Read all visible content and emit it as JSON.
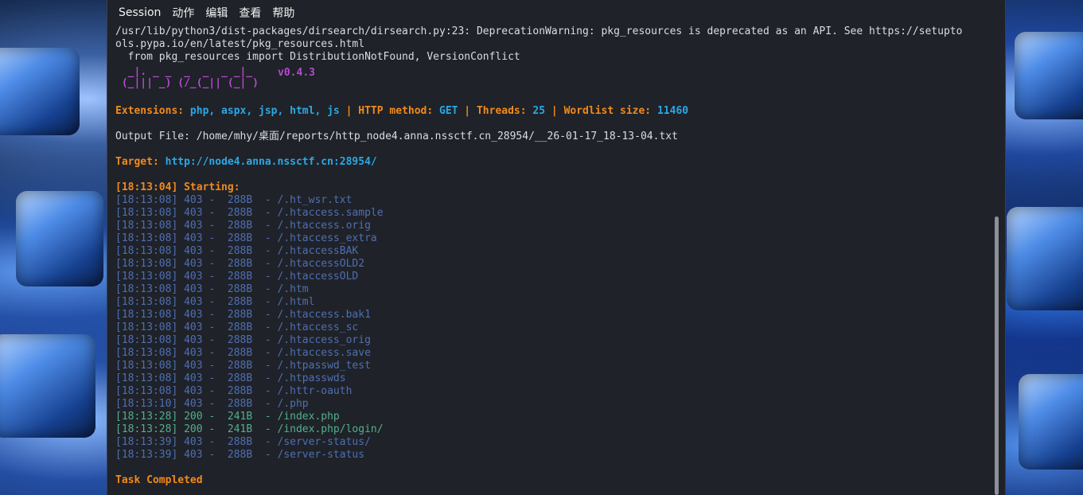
{
  "menu": [
    "Session",
    "动作",
    "编辑",
    "查看",
    "帮助"
  ],
  "warning": [
    "/usr/lib/python3/dist-packages/dirsearch/dirsearch.py:23: DeprecationWarning: pkg_resources is deprecated as an API. See https://setupto",
    "ols.pypa.io/en/latest/pkg_resources.html",
    "  from pkg_resources import DistributionNotFound, VersionConflict"
  ],
  "logo": {
    "line1": "  _|. _ _  _  _  _ _|_",
    "line2": " (_||| _) (/_(_|| (_| )",
    "version": "v0.4.3"
  },
  "config": {
    "ext_label": "Extensions: ",
    "ext_value": "php, aspx, jsp, html, js",
    "sep": " | ",
    "method_label": "HTTP method: ",
    "method_value": "GET",
    "threads_label": "Threads: ",
    "threads_value": "25",
    "wordlist_label": "Wordlist size: ",
    "wordlist_value": "11460"
  },
  "output_file": "Output File: /home/mhy/桌面/reports/http_node4.anna.nssctf.cn_28954/__26-01-17_18-13-04.txt",
  "target": {
    "label": "Target: ",
    "value": "http://node4.anna.nssctf.cn:28954/"
  },
  "starting": "[18:13:04] Starting:",
  "results": [
    {
      "text": "[18:13:08] 403 -  288B  - /.ht_wsr.txt",
      "status": "403"
    },
    {
      "text": "[18:13:08] 403 -  288B  - /.htaccess.sample",
      "status": "403"
    },
    {
      "text": "[18:13:08] 403 -  288B  - /.htaccess.orig",
      "status": "403"
    },
    {
      "text": "[18:13:08] 403 -  288B  - /.htaccess_extra",
      "status": "403"
    },
    {
      "text": "[18:13:08] 403 -  288B  - /.htaccessBAK",
      "status": "403"
    },
    {
      "text": "[18:13:08] 403 -  288B  - /.htaccessOLD2",
      "status": "403"
    },
    {
      "text": "[18:13:08] 403 -  288B  - /.htaccessOLD",
      "status": "403"
    },
    {
      "text": "[18:13:08] 403 -  288B  - /.htm",
      "status": "403"
    },
    {
      "text": "[18:13:08] 403 -  288B  - /.html",
      "status": "403"
    },
    {
      "text": "[18:13:08] 403 -  288B  - /.htaccess.bak1",
      "status": "403"
    },
    {
      "text": "[18:13:08] 403 -  288B  - /.htaccess_sc",
      "status": "403"
    },
    {
      "text": "[18:13:08] 403 -  288B  - /.htaccess_orig",
      "status": "403"
    },
    {
      "text": "[18:13:08] 403 -  288B  - /.htaccess.save",
      "status": "403"
    },
    {
      "text": "[18:13:08] 403 -  288B  - /.htpasswd_test",
      "status": "403"
    },
    {
      "text": "[18:13:08] 403 -  288B  - /.htpasswds",
      "status": "403"
    },
    {
      "text": "[18:13:08] 403 -  288B  - /.httr-oauth",
      "status": "403"
    },
    {
      "text": "[18:13:10] 403 -  288B  - /.php",
      "status": "403"
    },
    {
      "text": "[18:13:28] 200 -  241B  - /index.php",
      "status": "200"
    },
    {
      "text": "[18:13:28] 200 -  241B  - /index.php/login/",
      "status": "200"
    },
    {
      "text": "[18:13:39] 403 -  288B  - /server-status/",
      "status": "403"
    },
    {
      "text": "[18:13:39] 403 -  288B  - /server-status",
      "status": "403"
    }
  ],
  "completed": "Task Completed",
  "colors": {
    "orange": "#f28a1c",
    "cyan": "#2aa8e6",
    "purple": "#b44ad0",
    "status_403": "#4f6fb3",
    "status_200": "#52b08f"
  }
}
